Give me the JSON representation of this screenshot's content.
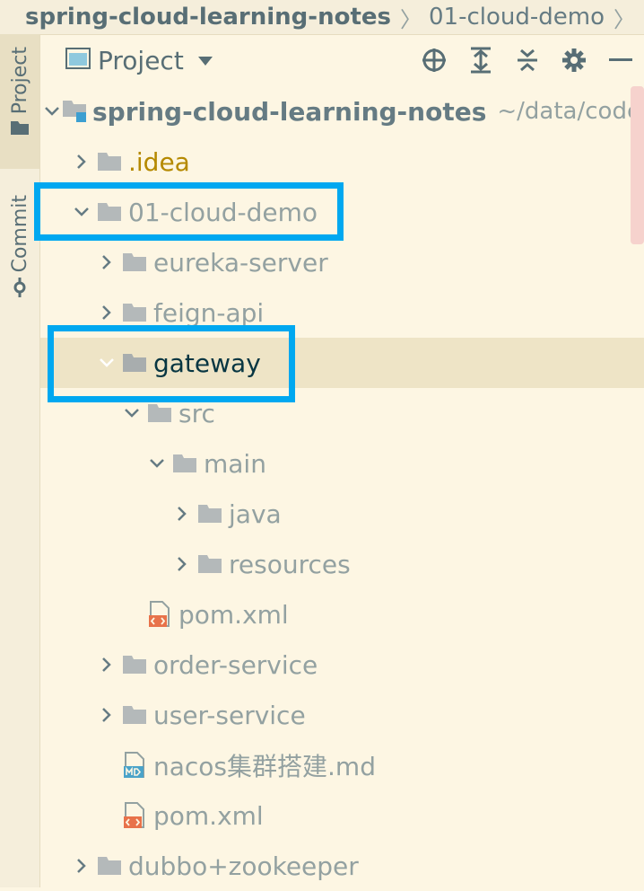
{
  "breadcrumb": {
    "root": "spring-cloud-learning-notes",
    "current": "01-cloud-demo"
  },
  "side_tabs": {
    "project": "Project",
    "commit": "Commit"
  },
  "toolwindow": {
    "title": "Project",
    "actions": [
      "locate-icon",
      "expand-all-icon",
      "collapse-all-icon",
      "gear-icon",
      "minimize-icon"
    ]
  },
  "tree": {
    "root": {
      "name": "spring-cloud-learning-notes",
      "path_hint": "~/data/codes/"
    },
    "rows": [
      {
        "label": ".idea"
      },
      {
        "label": "01-cloud-demo"
      },
      {
        "label": "eureka-server"
      },
      {
        "label": "feign-api"
      },
      {
        "label": "gateway"
      },
      {
        "label": "src"
      },
      {
        "label": "main"
      },
      {
        "label": "java"
      },
      {
        "label": "resources"
      },
      {
        "label": "pom.xml"
      },
      {
        "label": "order-service"
      },
      {
        "label": "user-service"
      },
      {
        "label": "nacos集群搭建.md"
      },
      {
        "label": "pom.xml"
      },
      {
        "label": "dubbo+zookeeper"
      }
    ]
  },
  "colors": {
    "background": "#fdf6e3",
    "selection": "#eee4c6",
    "highlight_box": "#00a8f0",
    "folder_icon": "#b4b9ba",
    "xml_badge": "#e8724a",
    "md_badge": "#4aa3c9"
  }
}
